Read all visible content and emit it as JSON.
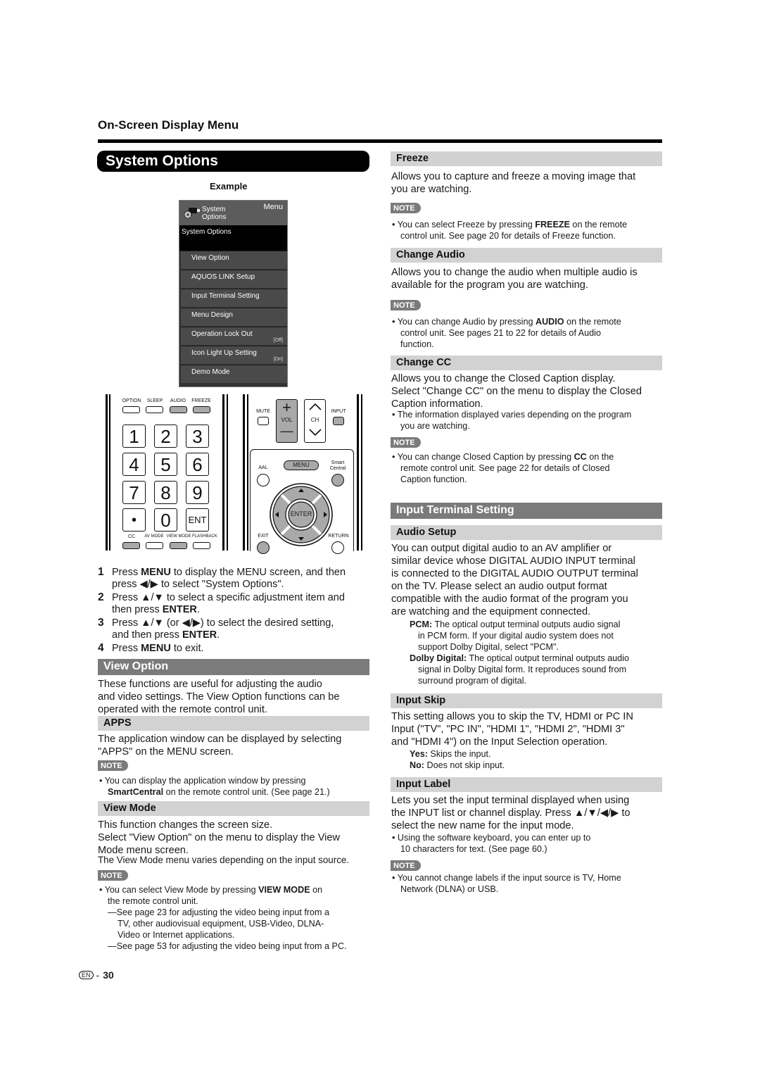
{
  "header": {
    "section_title": "On-Screen Display Menu",
    "chapter_title": "System Options",
    "example_label": "Example"
  },
  "osd_menu": {
    "header_title_line1": "System",
    "header_title_line2": "Options",
    "header_icon": "gear-plug-icon",
    "menu_label": "Menu",
    "selected": "System Options",
    "items": [
      {
        "label": "View Option",
        "value": ""
      },
      {
        "label": "AQUOS LINK Setup",
        "value": ""
      },
      {
        "label": "Input Terminal Setting",
        "value": ""
      },
      {
        "label": "Menu Design",
        "value": ""
      },
      {
        "label": "Operation Lock Out",
        "value": "[Off]"
      },
      {
        "label": "Icon Light Up Setting",
        "value": "[On]"
      },
      {
        "label": "Demo Mode",
        "value": ""
      }
    ]
  },
  "remote": {
    "top_labels": [
      "OPTION",
      "SLEEP",
      "AUDIO",
      "FREEZE"
    ],
    "number_keys": [
      "1",
      "2",
      "3",
      "4",
      "5",
      "6",
      "7",
      "8",
      "9",
      "•",
      "0",
      "ENT"
    ],
    "bottom_labels": [
      "CC",
      "AV MODE",
      "VIEW MODE",
      "FLASHBACK"
    ],
    "mute": "MUTE",
    "vol": "VOL",
    "vol_plus": "+",
    "vol_minus": "—",
    "ch": "CH",
    "input": "INPUT",
    "aal": "AAL",
    "menu": "MENU",
    "smart_central_1": "Smart",
    "smart_central_2": "Central",
    "enter": "ENTER",
    "exit": "EXIT",
    "return": "RETURN"
  },
  "steps": [
    {
      "num": "1",
      "pre": "Press ",
      "bold": "MENU",
      "post": " to display the MENU screen, and then",
      "line2": "press ◀/▶ to select \"System Options\"."
    },
    {
      "num": "2",
      "pre": "Press ▲/▼ to select a specific adjustment item and",
      "bold": "",
      "post": "",
      "line2_pre": "then press ",
      "line2_bold": "ENTER",
      "line2_post": "."
    },
    {
      "num": "3",
      "pre": "Press ▲/▼ (or ◀/▶) to select the desired setting,",
      "bold": "",
      "post": "",
      "line2_pre": "and then press ",
      "line2_bold": "ENTER",
      "line2_post": "."
    },
    {
      "num": "4",
      "pre": "Press ",
      "bold": "MENU",
      "post": " to exit."
    }
  ],
  "view_option": {
    "title": "View Option",
    "body": [
      "These functions are useful for adjusting the audio",
      "and video settings. The View Option functions can be",
      "operated with the remote control unit."
    ],
    "apps": {
      "title": "APPS",
      "body": [
        "The application window can be displayed by selecting",
        "\"APPS\" on the MENU screen."
      ],
      "note_label": "NOTE",
      "note_line1": "You can display the application window by pressing",
      "note_bold": "SmartCentral",
      "note_line2_post": " on the remote control unit. (See page 21.)"
    },
    "view_mode": {
      "title": "View Mode",
      "body": [
        "This function changes the screen size.",
        "Select \"View Option\" on the menu to display the View",
        "Mode menu screen."
      ],
      "body_small": "The View Mode menu varies depending on the input source.",
      "note_label": "NOTE",
      "note_pre": "You can select View Mode by pressing ",
      "note_bold": "VIEW MODE",
      "note_post": " on",
      "note_line2": "the remote control unit.",
      "sub_notes": [
        [
          "—See page 23 for adjusting the video being input from a",
          "TV, other audiovisual equipment, USB-Video, DLNA-",
          "Video or Internet applications."
        ],
        [
          "—See page 53 for adjusting the video being input from a PC."
        ]
      ]
    }
  },
  "freeze": {
    "title": "Freeze",
    "body": [
      "Allows you to capture and freeze a moving image that",
      "you are watching."
    ],
    "note_label": "NOTE",
    "note_pre": "You can select Freeze by pressing ",
    "note_bold": "FREEZE",
    "note_post": " on the remote",
    "note_line2": "control unit. See page 20 for details of Freeze function."
  },
  "change_audio": {
    "title": "Change Audio",
    "body": [
      "Allows you to change the audio when multiple audio is",
      "available for the program you are watching."
    ],
    "note_label": "NOTE",
    "note_pre": "You can change Audio by pressing ",
    "note_bold": "AUDIO",
    "note_post": " on the remote",
    "note_line2": "control unit. See pages 21 to 22 for details of Audio",
    "note_line3": "function."
  },
  "change_cc": {
    "title": "Change CC",
    "body": [
      "Allows you to change the Closed Caption display.",
      "Select \"Change CC\" on the menu to display the Closed",
      "Caption information."
    ],
    "bullet_line1": "The information displayed varies depending on the program",
    "bullet_line2": "you are watching.",
    "note_label": "NOTE",
    "note_pre": "You can change Closed Caption by pressing ",
    "note_bold": "CC",
    "note_post": " on the",
    "note_line2": "remote control unit. See page 22 for details of Closed",
    "note_line3": "Caption function."
  },
  "input_terminal": {
    "title": "Input Terminal Setting",
    "audio_setup": {
      "title": "Audio Setup",
      "body": [
        "You can output digital audio to an AV amplifier or",
        "similar device whose DIGITAL AUDIO INPUT terminal",
        "is connected to the DIGITAL AUDIO OUTPUT terminal",
        "on the TV. Please select an audio output format",
        "compatible with the audio format of the program you",
        "are watching and the equipment connected."
      ],
      "pcm_label": "PCM:",
      "pcm_line1": " The optical output terminal outputs audio signal",
      "pcm_line2": "in PCM form. If your digital audio system does not",
      "pcm_line3": "support Dolby Digital, select \"PCM\".",
      "dolby_label": "Dolby Digital:",
      "dolby_line1": " The optical output terminal outputs audio",
      "dolby_line2": "signal in Dolby Digital form. It reproduces sound from",
      "dolby_line3": "surround program of digital."
    },
    "input_skip": {
      "title": "Input Skip",
      "body": [
        "This setting allows you to skip the TV, HDMI or PC IN",
        "Input (\"TV\", \"PC IN\", \"HDMI 1\", \"HDMI 2\", \"HDMI 3\"",
        "and \"HDMI 4\") on the Input Selection operation."
      ],
      "yes_label": "Yes:",
      "yes_text": " Skips the input.",
      "no_label": "No:",
      "no_text": " Does not skip input."
    },
    "input_label": {
      "title": "Input Label",
      "body": [
        "Lets you set the input terminal displayed when using",
        "the INPUT list or channel display. Press ▲/▼/◀/▶ to",
        "select the new name for the input mode."
      ],
      "bullet_line1": "Using the software keyboard, you can enter up to",
      "bullet_line2": "10 characters for text. (See page 60.)",
      "note_label": "NOTE",
      "note_line1": "You cannot change labels if the input source is TV, Home",
      "note_line2": "Network (DLNA) or USB."
    }
  },
  "footer": {
    "lang_badge": "EN",
    "separator": "-",
    "page_number": "30"
  }
}
